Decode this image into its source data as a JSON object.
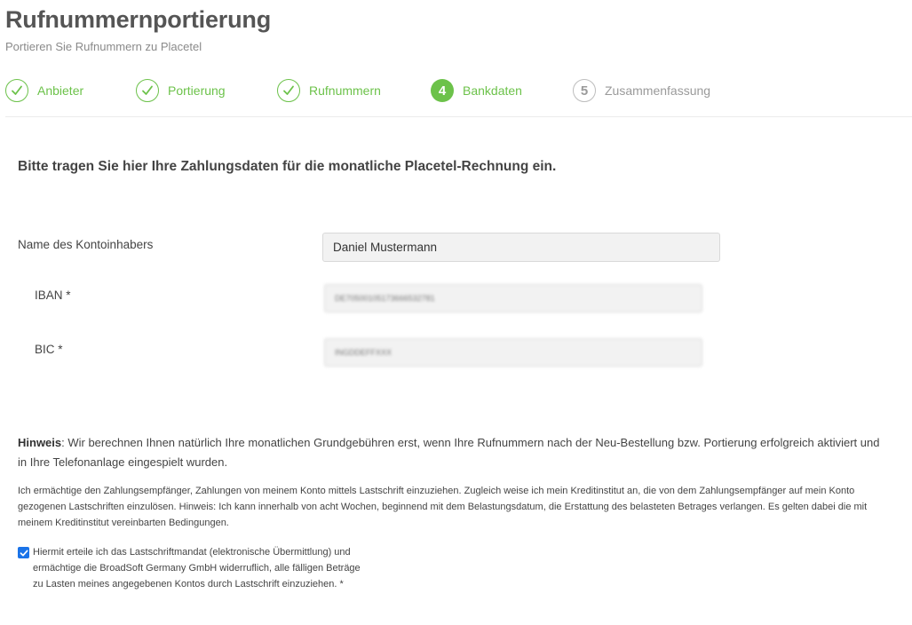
{
  "header": {
    "title": "Rufnummernportierung",
    "subtitle": "Portieren Sie Rufnummern zu Placetel"
  },
  "steps": [
    {
      "label": "Anbieter",
      "state": "done",
      "number": ""
    },
    {
      "label": "Portierung",
      "state": "done",
      "number": ""
    },
    {
      "label": "Rufnummern",
      "state": "done",
      "number": ""
    },
    {
      "label": "Bankdaten",
      "state": "active",
      "number": "4"
    },
    {
      "label": "Zusammenfassung",
      "state": "todo",
      "number": "5"
    }
  ],
  "form": {
    "intro": "Bitte tragen Sie hier Ihre Zahlungsdaten für die monatliche Placetel-Rechnung ein.",
    "holder": {
      "label": "Name des Kontoinhabers",
      "value": "Daniel Mustermann"
    },
    "iban": {
      "label": "IBAN *",
      "value": "DE70500105173666532781"
    },
    "bic": {
      "label": "BIC *",
      "value": "INGDDEFFXXX"
    }
  },
  "hint": {
    "bold": "Hinweis",
    "text": ": Wir berechnen Ihnen natürlich Ihre monatlichen Grundgebühren erst, wenn Ihre Rufnummern nach der Neu-Bestellung bzw. Portierung erfolgreich aktiviert und in Ihre Telefonanlage eingespielt wurden."
  },
  "mandate": {
    "text": "Ich ermächtige den Zahlungsempfänger, Zahlungen von meinem Konto mittels Lastschrift einzuziehen. Zugleich weise ich mein Kreditinstitut an, die von dem Zahlungsempfänger auf mein Konto gezogenen Lastschriften einzulösen. Hinweis: Ich kann innerhalb von acht Wochen, beginnend mit dem Belastungsdatum, die Erstattung des belasteten Betrages verlangen. Es gelten dabei die mit meinem Kreditinstitut vereinbarten Bedingungen.",
    "checkbox_label": "Hiermit erteile ich das Lastschriftmandat (elektronische Übermittlung) und ermächtige die BroadSoft Germany GmbH widerruflich, alle fälligen Beträge zu Lasten meines angegebenen Kontos durch Lastschrift einzuziehen.  *",
    "checked": true
  },
  "colors": {
    "accent": "#6cc24a",
    "checkbox": "#1a73e8"
  },
  "icons": {
    "done": "checkmark-icon"
  }
}
